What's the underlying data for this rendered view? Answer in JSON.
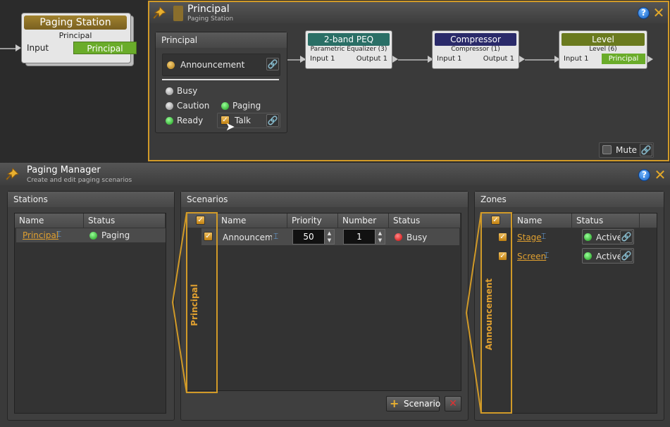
{
  "canvas": {
    "paging_station": {
      "title": "Paging Station",
      "subtitle": "Principal",
      "input_label": "Input",
      "output_label": "Principal"
    }
  },
  "principal_window": {
    "title": "Principal",
    "subtitle": "Paging Station",
    "panel": {
      "title": "Principal",
      "selected_scenario": "Announcement",
      "statuses": [
        {
          "label": "Busy",
          "led": "gray"
        },
        {
          "label": "Caution",
          "led": "gray"
        },
        {
          "label": "Paging",
          "led": "green"
        },
        {
          "label": "Ready",
          "led": "green"
        }
      ],
      "talk_label": "Talk"
    },
    "nodes": [
      {
        "title": "2-band PEQ",
        "subtitle": "Parametric Equalizer (3)",
        "input": "Input 1",
        "output": "Output 1",
        "color": "#2a6f66"
      },
      {
        "title": "Compressor",
        "subtitle": "Compressor (1)",
        "input": "Input 1",
        "output": "Output 1",
        "color": "#2a2a6a"
      },
      {
        "title": "Level",
        "subtitle": "Level (6)",
        "input": "Input 1",
        "output": "Principal",
        "color": "#6a7a1e"
      }
    ],
    "mute_label": "Mute",
    "accent_color": "#d19a28"
  },
  "paging_manager": {
    "title": "Paging Manager",
    "subtitle": "Create and edit paging scenarios",
    "stations": {
      "title": "Stations",
      "columns": [
        "Name",
        "Status"
      ],
      "rows": [
        {
          "name": "Principal",
          "status": "Paging",
          "led": "green"
        }
      ]
    },
    "scenarios": {
      "title": "Scenarios",
      "columns": [
        "Name",
        "Priority",
        "Number",
        "Status"
      ],
      "rows": [
        {
          "checked": true,
          "name": "Announceme",
          "priority": "50",
          "number": "1",
          "status": "Busy",
          "led": "red"
        }
      ],
      "side_label": "Principal",
      "add_button": "Scenario"
    },
    "zones": {
      "title": "Zones",
      "columns": [
        "Name",
        "Status"
      ],
      "rows": [
        {
          "checked": true,
          "name": "Stage",
          "status": "Active",
          "led": "green"
        },
        {
          "checked": true,
          "name": "Screen",
          "status": "Active",
          "led": "green"
        }
      ],
      "side_label": "Announcement"
    }
  }
}
